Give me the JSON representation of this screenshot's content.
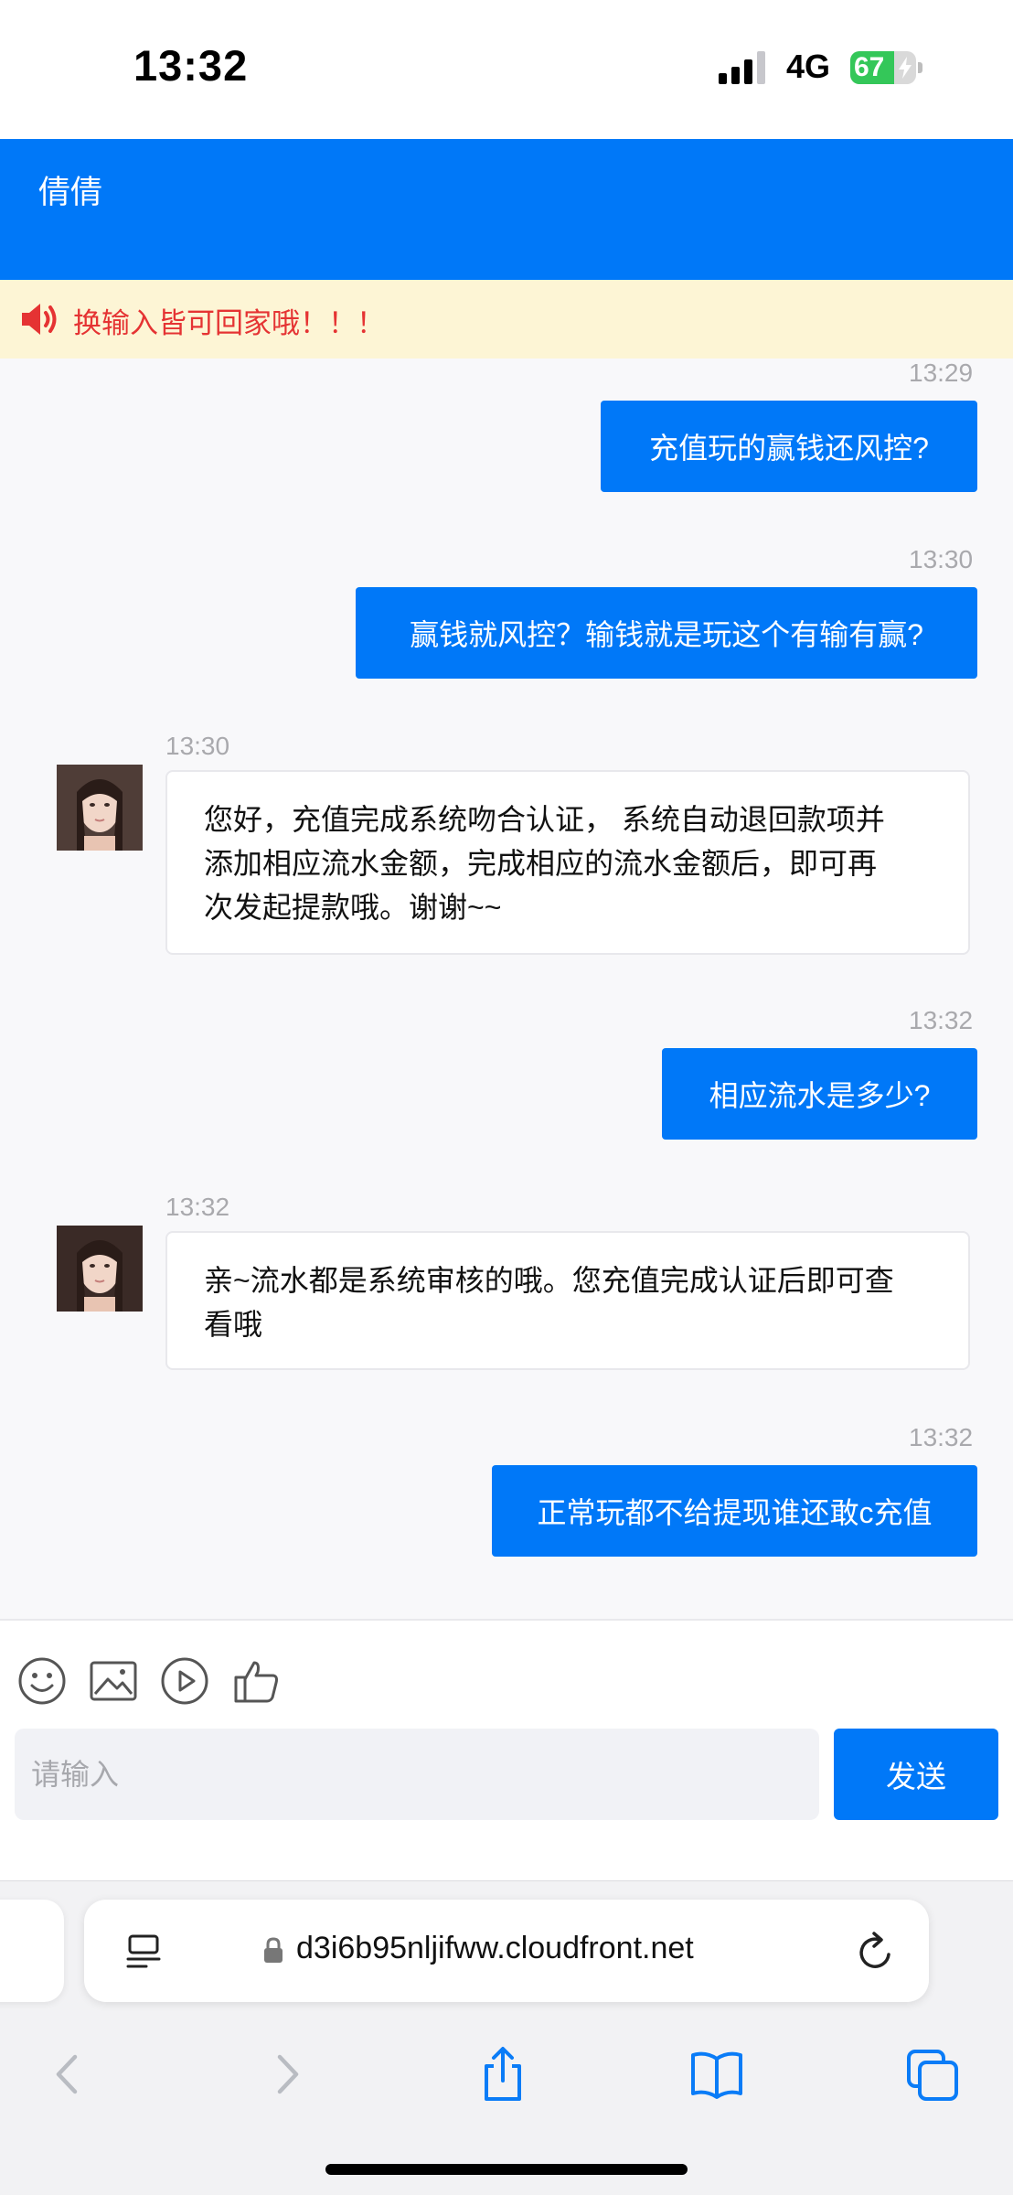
{
  "status_bar": {
    "time": "13:32",
    "network": "4G",
    "battery_percent": "67",
    "battery_level": 0.67
  },
  "header": {
    "title": "倩倩"
  },
  "notice": {
    "text": "换输入皆可回家哦！！！"
  },
  "messages": [
    {
      "direction": "out",
      "time": "13:29",
      "text": "充值玩的赢钱还风控?"
    },
    {
      "direction": "out",
      "time": "13:30",
      "text": "赢钱就风控？输钱就是玩这个有输有赢?"
    },
    {
      "direction": "in",
      "time": "13:30",
      "lines": [
        "您好，充值完成系统吻合认证， 系统自动退回款项并",
        "添加相应流水金额，完成相应的流水金额后，即可再",
        "次发起提款哦。谢谢~~"
      ]
    },
    {
      "direction": "out",
      "time": "13:32",
      "text": "相应流水是多少?"
    },
    {
      "direction": "in",
      "time": "13:32",
      "lines": [
        "亲~流水都是系统审核的哦。您充值完成认证后即可查",
        "看哦"
      ]
    },
    {
      "direction": "out",
      "time": "13:32",
      "text": "正常玩都不给提现谁还敢c充值"
    }
  ],
  "toolbar": {
    "icons": [
      "emoji-icon",
      "image-icon",
      "video-icon",
      "thumbs-up-icon"
    ]
  },
  "composer": {
    "placeholder": "请输入",
    "send_label": "发送"
  },
  "browser": {
    "url": "d3i6b95nljifww.cloudfront.net"
  },
  "colors": {
    "primary": "#0078f8",
    "notice_bg": "#fdf5d5",
    "notice_text": "#e53333",
    "chat_bg": "#f8f8fa"
  }
}
